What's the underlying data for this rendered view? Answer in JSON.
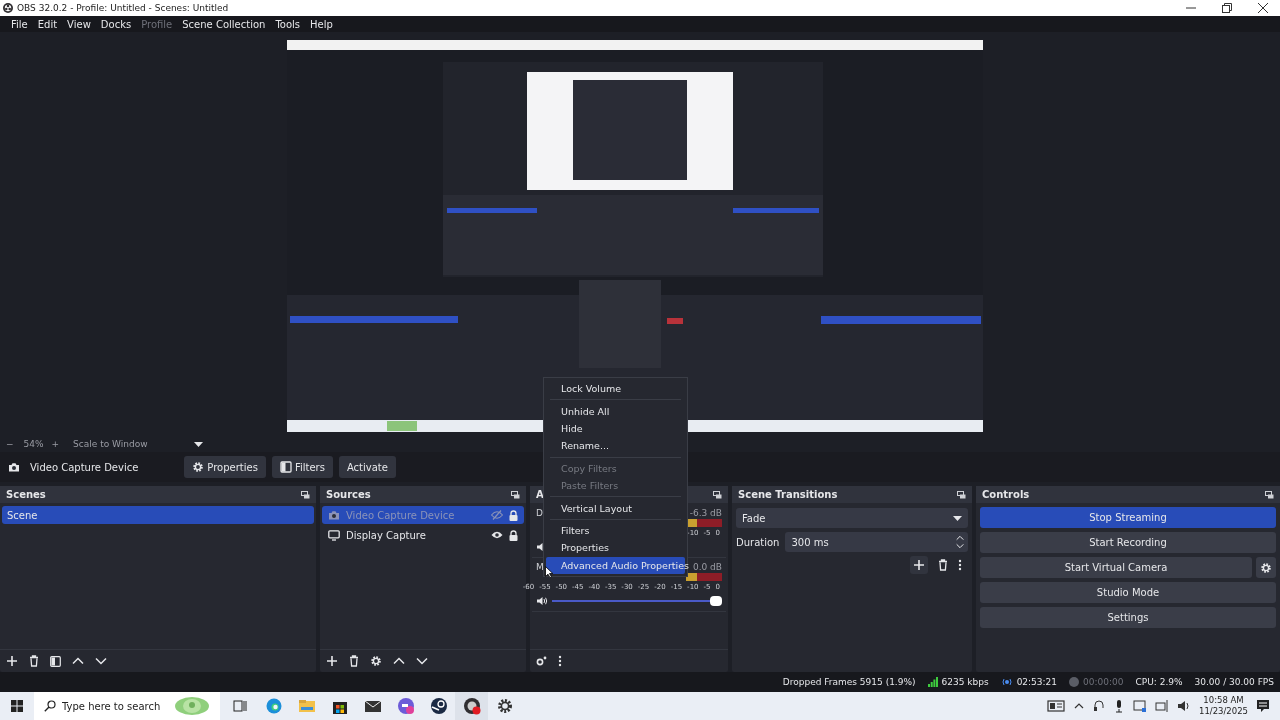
{
  "window": {
    "title": "OBS 32.0.2 - Profile: Untitled - Scenes: Untitled"
  },
  "menu_bar": [
    {
      "label": "File",
      "disabled": false
    },
    {
      "label": "Edit",
      "disabled": false
    },
    {
      "label": "View",
      "disabled": false
    },
    {
      "label": "Docks",
      "disabled": false
    },
    {
      "label": "Profile",
      "disabled": true
    },
    {
      "label": "Scene Collection",
      "disabled": false
    },
    {
      "label": "Tools",
      "disabled": false
    },
    {
      "label": "Help",
      "disabled": false
    }
  ],
  "zoom_bar": {
    "zoom_out": "−",
    "zoom": "54%",
    "zoom_in": "+",
    "scale_mode": "Scale to Window"
  },
  "source_toolbar": {
    "source": "Video Capture Device",
    "buttons": [
      "Properties",
      "Filters",
      "Activate"
    ]
  },
  "scenes": {
    "title": "Scenes",
    "items": [
      {
        "label": "Scene",
        "selected": true
      }
    ]
  },
  "sources": {
    "title": "Sources",
    "items": [
      {
        "label": "Video Capture Device",
        "kind": "camera",
        "visible": false,
        "locked": true,
        "selected": true
      },
      {
        "label": "Display Capture",
        "kind": "display",
        "visible": true,
        "locked": true,
        "selected": false
      }
    ]
  },
  "audio_mixer": {
    "title": "A",
    "channels": [
      {
        "name": "D",
        "reading": "-6.3 dB",
        "ticks": [
          "-10",
          "-5",
          "0"
        ]
      },
      {
        "name": "M",
        "reading": "0.0 dB",
        "ticks": [
          "-60",
          "-55",
          "-50",
          "-45",
          "-40",
          "-35",
          "-30",
          "-25",
          "-20",
          "-15",
          "-10",
          "-5",
          "0"
        ],
        "level": 1.0
      }
    ]
  },
  "context_menu": {
    "items": [
      {
        "kind": "item",
        "label": "Lock Volume",
        "disabled": false,
        "selected": false
      },
      {
        "kind": "separator"
      },
      {
        "kind": "item",
        "label": "Unhide All",
        "disabled": false,
        "selected": false
      },
      {
        "kind": "item",
        "label": "Hide",
        "disabled": false,
        "selected": false
      },
      {
        "kind": "item",
        "label": "Rename...",
        "disabled": false,
        "selected": false
      },
      {
        "kind": "separator"
      },
      {
        "kind": "item",
        "label": "Copy Filters",
        "disabled": true,
        "selected": false
      },
      {
        "kind": "item",
        "label": "Paste Filters",
        "disabled": true,
        "selected": false
      },
      {
        "kind": "separator"
      },
      {
        "kind": "item",
        "label": "Vertical Layout",
        "disabled": false,
        "selected": false
      },
      {
        "kind": "separator"
      },
      {
        "kind": "item",
        "label": "Filters",
        "disabled": false,
        "selected": false
      },
      {
        "kind": "item",
        "label": "Properties",
        "disabled": false,
        "selected": false
      },
      {
        "kind": "item",
        "label": "Advanced Audio Properties",
        "disabled": false,
        "selected": true
      }
    ]
  },
  "scene_transitions": {
    "title": "Scene Transitions",
    "transition": "Fade",
    "duration_label": "Duration",
    "duration": "300 ms"
  },
  "controls": {
    "title": "Controls",
    "buttons": [
      {
        "label": "Stop Streaming",
        "active": true,
        "settings": false
      },
      {
        "label": "Start Recording",
        "active": false,
        "settings": false
      },
      {
        "label": "Start Virtual Camera",
        "active": false,
        "settings": true
      },
      {
        "label": "Studio Mode",
        "active": false,
        "settings": false
      },
      {
        "label": "Settings",
        "active": false,
        "settings": false
      }
    ]
  },
  "status_bar": {
    "dropped_frames": "Dropped Frames 5915 (1.9%)",
    "bitrate": "6235 kbps",
    "stream_time": "02:53:21",
    "record_time": "00:00:00",
    "cpu": "CPU: 2.9%",
    "fps": "30.00 / 30.00 FPS"
  },
  "taskbar": {
    "search_placeholder": "Type here to search",
    "time": "10:58 AM",
    "date": "11/23/2025"
  }
}
